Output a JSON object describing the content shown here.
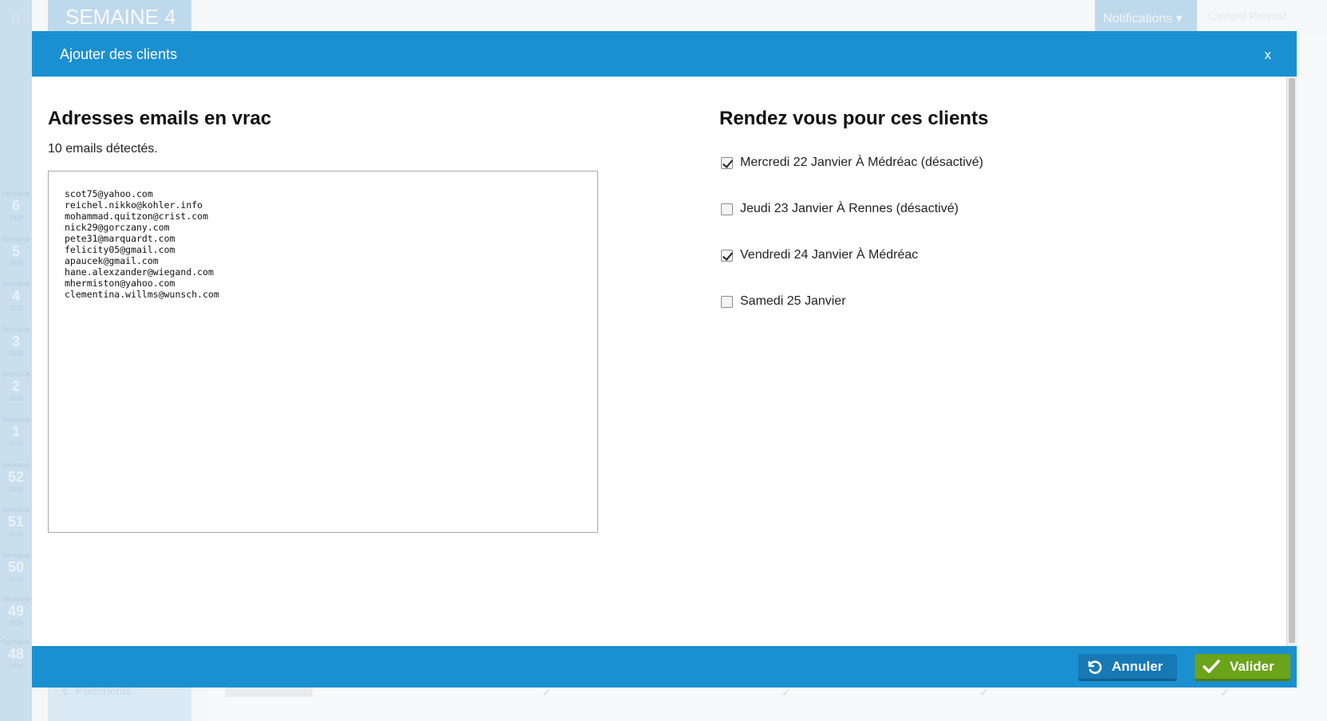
{
  "background": {
    "title": "SEMAINE 4",
    "notifications_label": "Notifications",
    "user_label": "Laurent Prévost",
    "paiements_label": "Paiements",
    "sidebar_weeks": [
      {
        "label": "Semaine",
        "num": "6",
        "year": "2020"
      },
      {
        "label": "Semaine",
        "num": "5",
        "year": "2020"
      },
      {
        "label": "Semaine",
        "num": "4",
        "year": "2020"
      },
      {
        "label": "Semaine",
        "num": "3",
        "year": "2020"
      },
      {
        "label": "Semaine",
        "num": "2",
        "year": "2020"
      },
      {
        "label": "Semaine",
        "num": "1",
        "year": "2020"
      },
      {
        "label": "Semaine",
        "num": "52",
        "year": "2019"
      },
      {
        "label": "Semaine",
        "num": "51",
        "year": "2019"
      },
      {
        "label": "Semaine",
        "num": "50",
        "year": "2019"
      },
      {
        "label": "Semaine",
        "num": "49",
        "year": "2019"
      },
      {
        "label": "Semaine",
        "num": "48",
        "year": "2019"
      }
    ]
  },
  "modal": {
    "title": "Ajouter des clients",
    "close_label": "x",
    "emails_section": {
      "title": "Adresses emails en vrac",
      "count_text": "10 emails détectés.",
      "emails_text": "scot75@yahoo.com\nreichel.nikko@kohler.info\nmohammad.quitzon@crist.com\nnick29@gorczany.com\npete31@marquardt.com\nfelicity05@gmail.com\napaucek@gmail.com\nhane.alexzander@wiegand.com\nmhermiston@yahoo.com\nclementina.willms@wunsch.com"
    },
    "rdv_section": {
      "title": "Rendez vous pour ces clients",
      "options": [
        {
          "label": "Mercredi 22 Janvier À Médréac (désactivé)",
          "checked": true
        },
        {
          "label": "Jeudi 23 Janvier À Rennes (désactivé)",
          "checked": false
        },
        {
          "label": "Vendredi 24 Janvier À Médréac",
          "checked": true
        },
        {
          "label": "Samedi 25 Janvier",
          "checked": false
        }
      ]
    },
    "footer": {
      "cancel_label": "Annuler",
      "ok_label": "Valider"
    }
  },
  "colors": {
    "header_blue": "#1b90d0",
    "cancel_blue": "#1679b3",
    "ok_green": "#6ba31a"
  }
}
